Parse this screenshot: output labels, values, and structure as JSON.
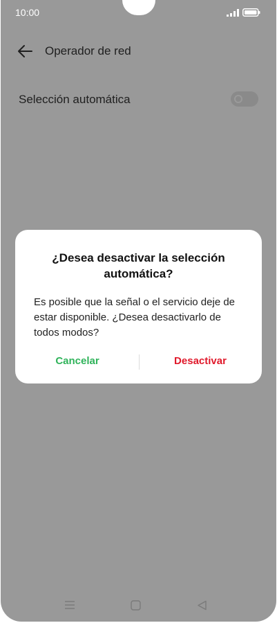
{
  "status_bar": {
    "time": "10:00"
  },
  "app_bar": {
    "title": "Operador de red",
    "back_icon": "arrow-left"
  },
  "setting": {
    "label": "Selección automática",
    "toggle_state": "on"
  },
  "dialog": {
    "title": "¿Desea desactivar la selección automática?",
    "message": "Es posible que la señal o el servicio deje de estar disponible. ¿Desea desactivarlo de todos modos?",
    "cancel_label": "Cancelar",
    "confirm_label": "Desactivar"
  },
  "colors": {
    "scrim": "#999999",
    "cancel": "#2fb35a",
    "confirm": "#e0192b"
  },
  "nav_bar": {
    "icons": [
      "menu-icon",
      "home-icon",
      "back-triangle-icon"
    ]
  }
}
